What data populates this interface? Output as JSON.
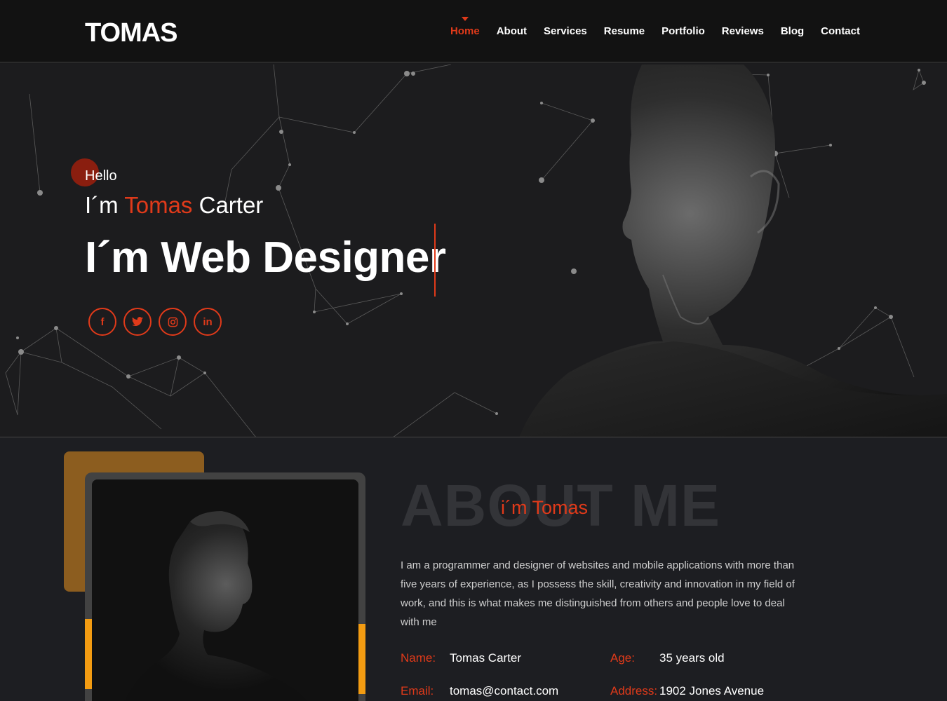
{
  "brand": {
    "logo": "TOMAS",
    "accent": "#e03a1a",
    "orange": "#f39c12"
  },
  "nav": [
    {
      "label": "Home",
      "active": true
    },
    {
      "label": "About"
    },
    {
      "label": "Services"
    },
    {
      "label": "Resume"
    },
    {
      "label": "Portfolio"
    },
    {
      "label": "Reviews"
    },
    {
      "label": "Blog"
    },
    {
      "label": "Contact"
    }
  ],
  "hero": {
    "hello": "Hello",
    "im_prefix": "I´m",
    "first_name": "Tomas",
    "last_name": "Carter",
    "role": "I´m Web Designer",
    "socials": [
      {
        "icon": "facebook-icon",
        "glyph": "f"
      },
      {
        "icon": "twitter-icon",
        "glyph": "t"
      },
      {
        "icon": "instagram-icon",
        "glyph": "◎"
      },
      {
        "icon": "linkedin-icon",
        "glyph": "in"
      }
    ]
  },
  "about": {
    "bg_title": "ABOUT ME",
    "subtitle": "i´m Tomas",
    "text": "I am a programmer and designer of websites and mobile applications with more than five years of experience, as I possess the skill, creativity and innovation in my field of work, and this is what makes me distinguished from others and people love to deal with me",
    "info": [
      {
        "key": "Name:",
        "value": "Tomas Carter"
      },
      {
        "key": "Age:",
        "value": "35 years old"
      },
      {
        "key": "Email:",
        "value": "tomas@contact.com"
      },
      {
        "key": "Address:",
        "value": "1902 Jones Avenue"
      }
    ]
  }
}
